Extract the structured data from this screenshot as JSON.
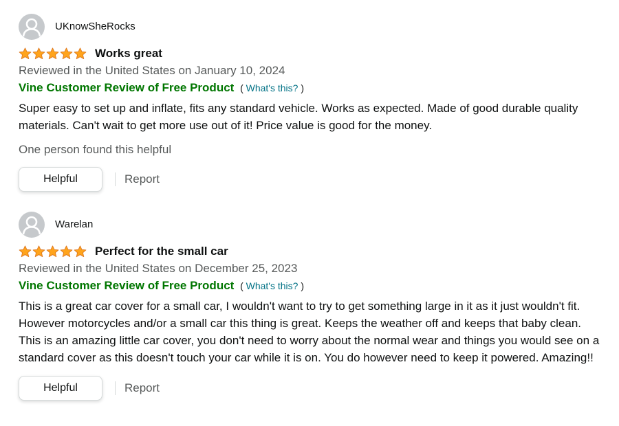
{
  "reviews": [
    {
      "profile_name": "UKnowSheRocks",
      "rating": 5,
      "title": "Works great",
      "date_text": "Reviewed in the United States on January 10, 2024",
      "vine_label": "Vine Customer Review of Free Product",
      "whats_this": "What's this?",
      "body": "Super easy to set up and inflate, fits any standard vehicle. Works as expected. Made of good durable quality materials. Can't wait to get more use out of it! Price value is good for the money.",
      "helpful_count": "One person found this helpful",
      "helpful_label": "Helpful",
      "report_label": "Report"
    },
    {
      "profile_name": "Warelan",
      "rating": 5,
      "title": "Perfect for the small car",
      "date_text": "Reviewed in the United States on December 25, 2023",
      "vine_label": "Vine Customer Review of Free Product",
      "whats_this": "What's this?",
      "body": "This is a great car cover for a small car, I wouldn't want to try to get something large in it as it just wouldn't fit. However motorcycles and/or a small car this thing is great. Keeps the weather off and keeps that baby clean. This is an amazing little car cover, you don't need to worry about the normal wear and things you would see on a standard cover as this doesn't touch your car while it is on. You do however need to keep it powered. Amazing!!",
      "helpful_label": "Helpful",
      "report_label": "Report"
    }
  ],
  "colors": {
    "star": "#ffa41c",
    "star_stroke": "#de7921",
    "vine": "#007600",
    "link": "#007185",
    "muted": "#565959"
  },
  "icons": {
    "avatar": "default-profile-icon",
    "star": "star-icon"
  }
}
